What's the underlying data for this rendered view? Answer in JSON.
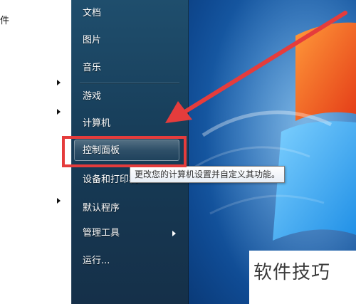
{
  "left_pane": {
    "fragment": "件"
  },
  "menu": {
    "items": [
      {
        "label": "文档"
      },
      {
        "label": "图片"
      },
      {
        "label": "音乐"
      },
      {
        "label": "游戏"
      },
      {
        "label": "计算机"
      },
      {
        "label": "控制面板"
      },
      {
        "label": "设备和打印机"
      },
      {
        "label": "默认程序"
      },
      {
        "label": "管理工具"
      },
      {
        "label": "运行..."
      }
    ]
  },
  "tooltip": {
    "text": "更改您的计算机设置并自定义其功能。"
  },
  "watermark": {
    "text": "软件技巧"
  },
  "colors": {
    "annotation_red": "#e53c3c",
    "menu_dark": "#183f5b"
  }
}
